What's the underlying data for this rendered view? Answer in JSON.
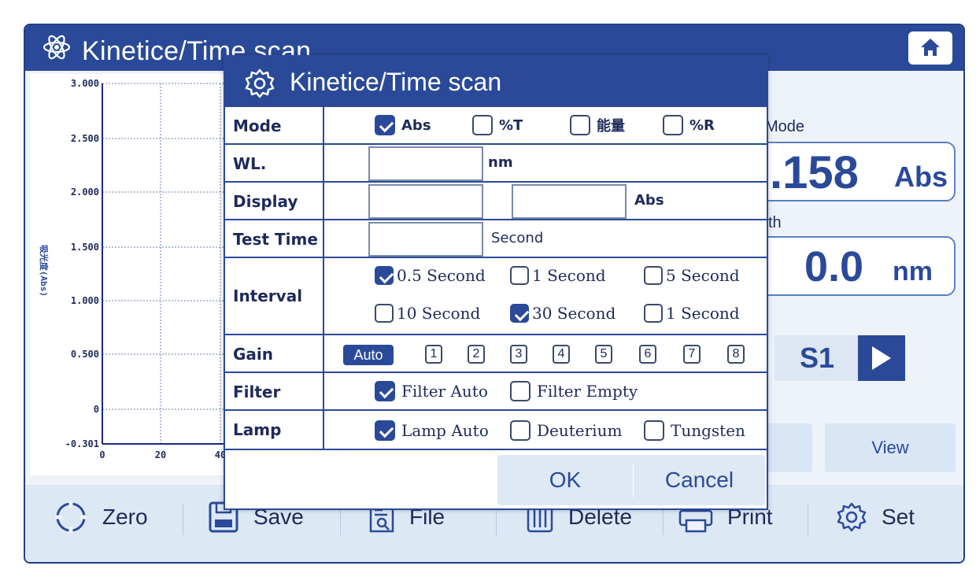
{
  "screen": {
    "title": "Kinetice/Time scan",
    "icons": {
      "app": "atom-icon",
      "home": "home-icon"
    }
  },
  "chart": {
    "y_ticks": [
      "3.000",
      "2.500",
      "2.000",
      "1.500",
      "1.000",
      "0.500",
      "0",
      "-0.301"
    ],
    "x_ticks": [
      "0",
      "20",
      "40"
    ],
    "y_axis_label": "吸光度(Abs)"
  },
  "right_panel": {
    "mode_label": "Mode",
    "mode_value": ".158",
    "mode_unit": "Abs",
    "wl_label": "th",
    "wl_value": "0.0",
    "wl_unit": "nm",
    "sample": "S1",
    "view_label": "View"
  },
  "toolbar": {
    "zero": "Zero",
    "save": "Save",
    "file": "File",
    "delete": "Delete",
    "print": "Print",
    "set": "Set"
  },
  "dialog": {
    "title": "Kinetice/Time scan",
    "rows": {
      "mode": {
        "label": "Mode",
        "options": [
          {
            "label": "Abs",
            "checked": true
          },
          {
            "label": "%T",
            "checked": false
          },
          {
            "label": "能量",
            "checked": false
          },
          {
            "label": "%R",
            "checked": false
          }
        ]
      },
      "wl": {
        "label": "WL.",
        "value": "",
        "unit": "nm"
      },
      "display": {
        "label": "Display",
        "min": "",
        "max": "",
        "unit": "Abs"
      },
      "test_time": {
        "label": "Test Time",
        "value": "",
        "unit": "Second"
      },
      "interval": {
        "label": "Interval",
        "options": [
          {
            "label": "0.5 Second",
            "checked": true
          },
          {
            "label": "1 Second",
            "checked": false
          },
          {
            "label": "5 Second",
            "checked": false
          },
          {
            "label": "10 Second",
            "checked": false
          },
          {
            "label": "30 Second",
            "checked": true
          },
          {
            "label": "1 Second",
            "checked": false
          }
        ]
      },
      "gain": {
        "label": "Gain",
        "auto": "Auto",
        "levels": [
          "1",
          "2",
          "3",
          "4",
          "5",
          "6",
          "7",
          "8"
        ]
      },
      "filter": {
        "label": "Filter",
        "options": [
          {
            "label": "Filter Auto",
            "checked": true
          },
          {
            "label": "Filter Empty",
            "checked": false
          }
        ]
      },
      "lamp": {
        "label": "Lamp",
        "options": [
          {
            "label": "Lamp Auto",
            "checked": true
          },
          {
            "label": "Deuterium",
            "checked": false
          },
          {
            "label": "Tungsten",
            "checked": false
          }
        ]
      }
    },
    "ok": "OK",
    "cancel": "Cancel",
    "colors": {
      "primary": "#2a4a99",
      "footer": "#dfe8f5"
    }
  }
}
